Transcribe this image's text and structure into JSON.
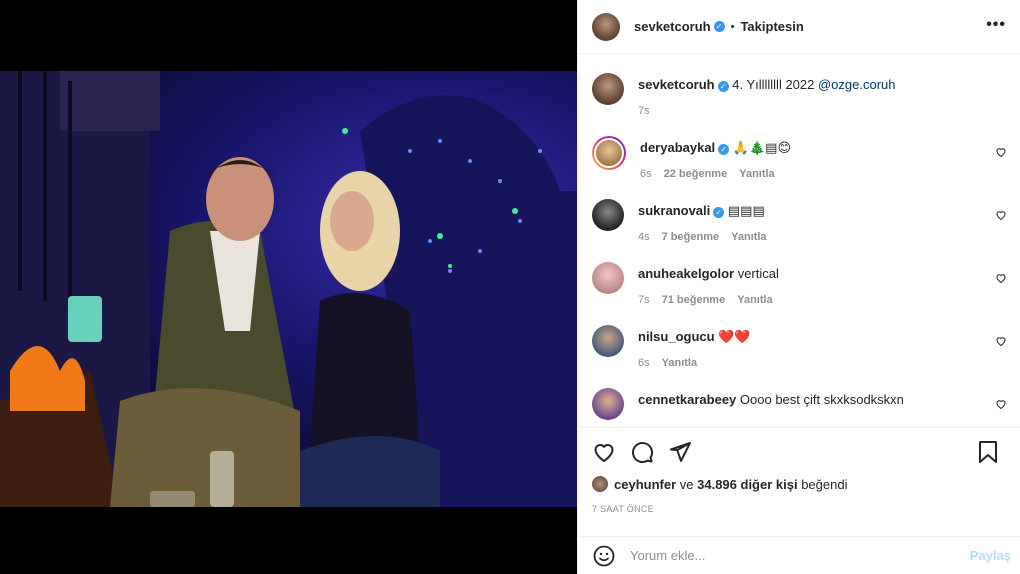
{
  "header": {
    "username": "sevketcoruh",
    "verified": true,
    "follow_status": "Takiptesin",
    "more": "•••"
  },
  "caption": {
    "username": "sevketcoruh",
    "text": "4. Yıllllllll 2022",
    "mention": "@ozge.coruh",
    "time": "7s"
  },
  "comments": [
    {
      "username": "deryabaykal",
      "verified": true,
      "text": "🙏🎄▤😊",
      "time": "6s",
      "likes": "22 beğenme",
      "reply": "Yanıtla",
      "story_ring": true
    },
    {
      "username": "sukranovali",
      "verified": true,
      "text": "▤▤▤",
      "time": "4s",
      "likes": "7 beğenme",
      "reply": "Yanıtla"
    },
    {
      "username": "anuheakelgolor",
      "verified": false,
      "text": "vertical",
      "time": "7s",
      "likes": "71 beğenme",
      "reply": "Yanıtla"
    },
    {
      "username": "nilsu_ogucu",
      "verified": false,
      "text": "❤️❤️",
      "time": "6s",
      "likes": "",
      "reply": "Yanıtla"
    },
    {
      "username": "cennetkarabeey",
      "verified": false,
      "text": "Oooo best çift skxksodkskxn",
      "time": "",
      "likes": "",
      "reply": ""
    }
  ],
  "likes": {
    "user": "ceyhunfer",
    "connector": "ve",
    "count": "34.896 diğer kişi",
    "suffix": "beğendi"
  },
  "timestamp": "7 SAAT ÖNCE",
  "add_comment": {
    "placeholder": "Yorum ekle...",
    "post_label": "Paylaş"
  },
  "colors": {
    "accent": "#3897f0",
    "mention": "#00376b",
    "muted": "#8e8e8e",
    "post_disabled": "#b2dffc"
  }
}
